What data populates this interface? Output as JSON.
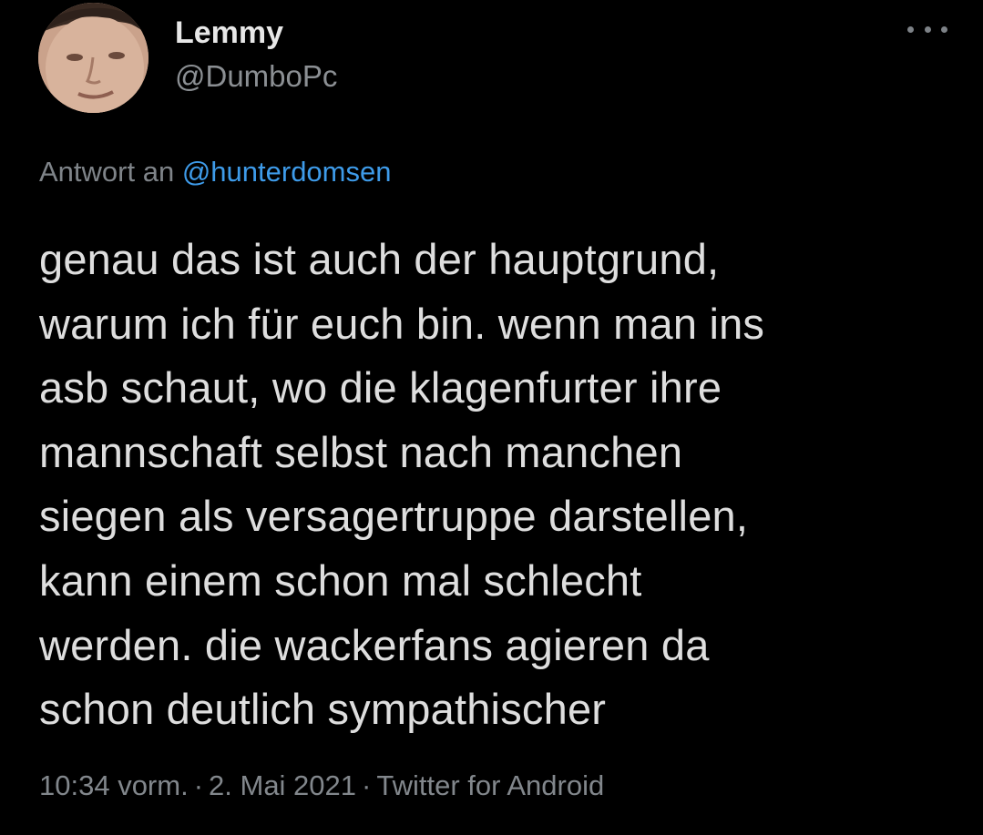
{
  "author": {
    "name": "Lemmy",
    "handle": "@DumboPc",
    "avatar_icon": "profile-photo"
  },
  "more_menu": {
    "icon": "more-horizontal-icon"
  },
  "reply": {
    "prefix": "Antwort an",
    "mention": "@hunterdomsen"
  },
  "tweet": {
    "lines": [
      "genau das ist auch der hauptgrund,",
      "warum ich für euch bin. wenn man ins",
      "asb schaut, wo die klagenfurter ihre",
      "mannschaft selbst nach manchen",
      "siegen als versagertruppe darstellen,",
      "kann einem schon mal schlecht",
      "werden. die wackerfans agieren da",
      "schon deutlich sympathischer"
    ]
  },
  "meta": {
    "time": "10:34 vorm.",
    "date": "2. Mai 2021",
    "client": "Twitter for Android",
    "separator": "·"
  },
  "colors": {
    "background": "#000000",
    "link": "#3e9be9",
    "secondary_text": "#82878c"
  }
}
